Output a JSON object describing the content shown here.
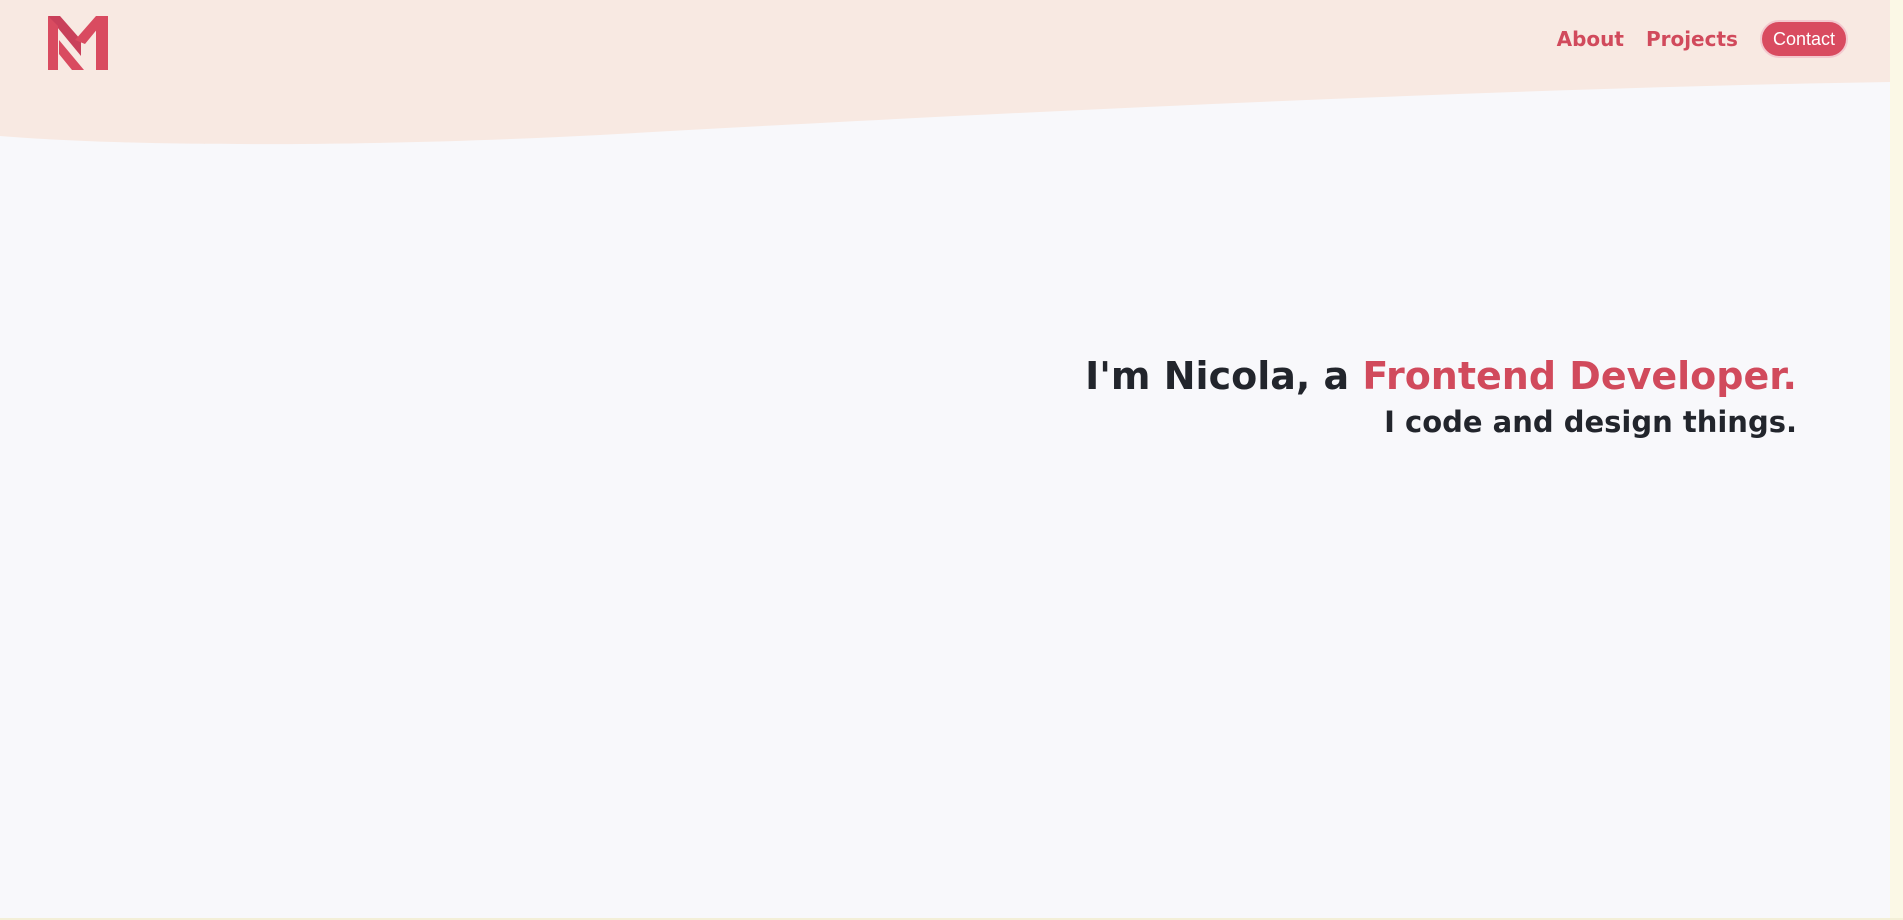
{
  "brand": {
    "logo_icon": "monogram-m-logo",
    "accent_color": "#d94b60",
    "header_bg": "#f8e9e2",
    "page_bg": "#f8f8fb"
  },
  "nav": {
    "about_label": "About",
    "projects_label": "Projects",
    "contact_label": "Contact"
  },
  "hero": {
    "intro": "I'm Nicola, a ",
    "highlight": "Frontend Developer.",
    "tagline": "I code and design things."
  }
}
